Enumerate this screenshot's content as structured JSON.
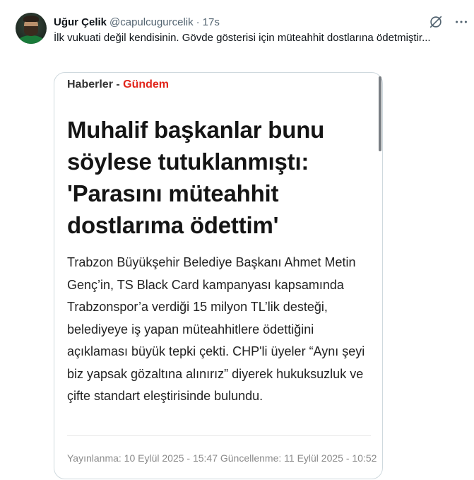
{
  "tweet": {
    "author_name": "Uğur Çelik",
    "handle": "@capulcugurcelik",
    "separator": "·",
    "time": "17s",
    "text": "İlk vukuati değil kendisinin. Gövde gösterisi için müteahhit dostlarına ödetmiştir...",
    "icons": [
      "grok-icon",
      "more-icon"
    ]
  },
  "media": {
    "category_prefix": "Haberler - ",
    "category": "Gündem",
    "headline": "Muhalif başkanlar bunu söylese tutuklanmıştı: 'Parasını müteahhit dostlarıma ödettim'",
    "summary": "Trabzon Büyükşehir Belediye Başkanı Ahmet Metin Genç’in, TS Black Card kampanyası kapsamında Trabzonspor’a verdiği 15 milyon TL’lik desteği, belediyeye iş yapan müteahhitlere ödettiğini açıklaması büyük tepki çekti. CHP'li üyeler “Aynı şeyi biz yapsak gözaltına alınırız” diyerek hukuksuzluk ve çifte standart eleştirisinde bulundu.",
    "dates": "Yayınlanma: 10 Eylül 2025 - 15:47 Güncellenme: 11 Eylül 2025 - 10:52"
  },
  "colors": {
    "category_accent": "#e1251b",
    "secondary_text": "#536471",
    "border": "#cfd9de"
  }
}
